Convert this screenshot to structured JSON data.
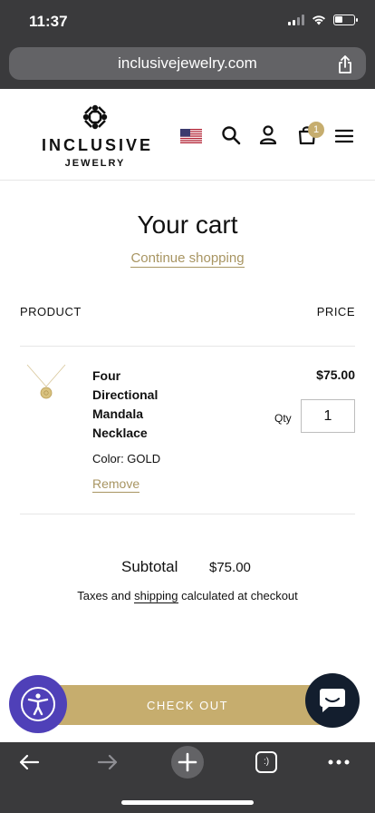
{
  "status_bar": {
    "time": "11:37"
  },
  "browser": {
    "url": "inclusivejewelry.com",
    "tab_icon_label": ":)"
  },
  "brand": {
    "line1": "INCLUSIVE",
    "line2": "JEWELRY"
  },
  "header": {
    "cart_count": "1"
  },
  "cart": {
    "title": "Your cart",
    "continue_label": "Continue shopping",
    "col_product": "PRODUCT",
    "col_price": "PRICE",
    "item": {
      "name": "Four Directional Mandala Necklace",
      "color": "Color: GOLD",
      "remove_label": "Remove",
      "price": "$75.00",
      "qty_label": "Qty",
      "qty_value": "1"
    },
    "subtotal_label": "Subtotal",
    "subtotal_value": "$75.00",
    "tax_prefix": "Taxes and ",
    "tax_link": "shipping",
    "tax_suffix": " calculated at checkout",
    "checkout_label": "CHECK OUT"
  },
  "colors": {
    "gold": "#c6ad6e",
    "link_gold": "#a89562",
    "accessibility": "#4f40b8",
    "chat": "#131e2e"
  }
}
